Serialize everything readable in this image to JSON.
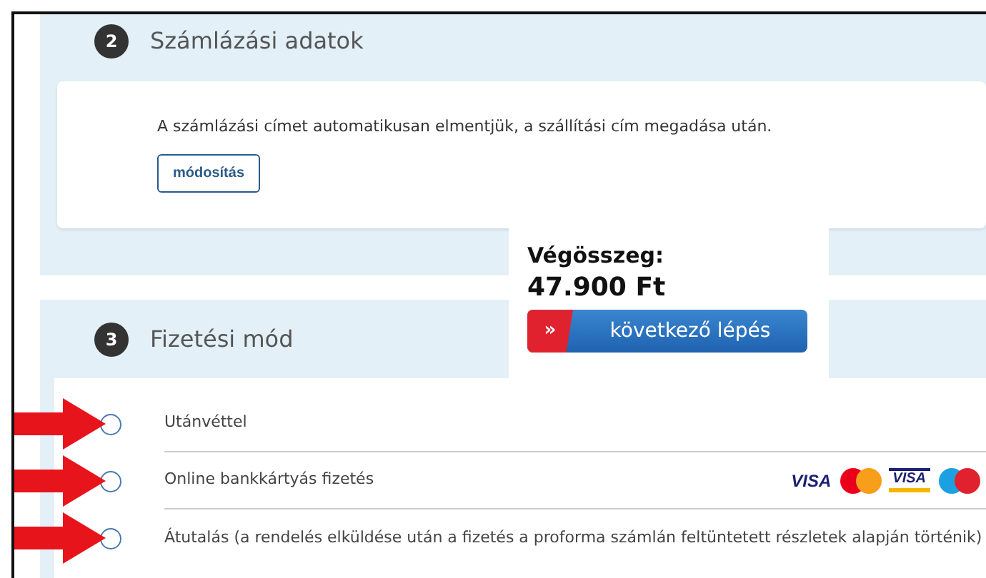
{
  "billing": {
    "step": "2",
    "title": "Számlázási adatok",
    "note": "A számlázási címet automatikusan elmentjük, a szállítási cím megadása után.",
    "edit_button": "módosítás"
  },
  "payment": {
    "step": "3",
    "title": "Fizetési mód",
    "options": [
      {
        "label": "Utánvéttel",
        "selected": false,
        "marked": true
      },
      {
        "label": "Online bankkártyás fizetés",
        "selected": false,
        "marked": true,
        "card_logos": [
          {
            "kind": "visa",
            "text": "VISA"
          },
          {
            "kind": "mastercard"
          },
          {
            "kind": "visa-electron",
            "text": "VISA"
          },
          {
            "kind": "maestro"
          }
        ]
      },
      {
        "label": "Átutalás (a rendelés elküldése után a fizetés a proforma számlán feltüntetett részletek alapján történik)",
        "selected": false,
        "marked": true
      }
    ]
  },
  "summary": {
    "label": "Végösszeg:",
    "total": "47.900 Ft",
    "next_button": {
      "icon": "»",
      "label": "következő lépés"
    }
  }
}
